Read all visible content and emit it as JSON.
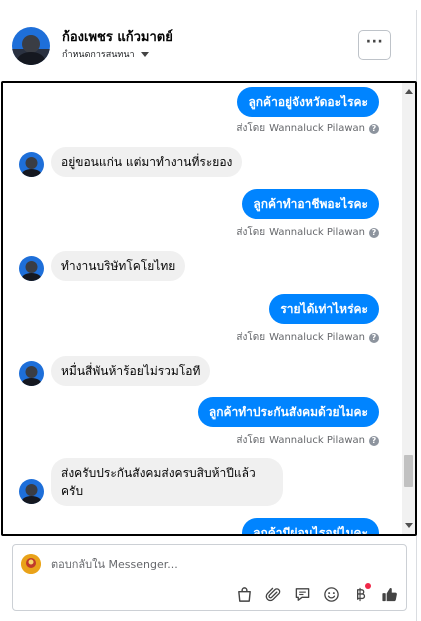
{
  "header": {
    "contact_name": "ก้องเพชร แก้วมาตย์",
    "assign_label": "กำหนดการสนทนา",
    "more_label": "···"
  },
  "messages": [
    {
      "type": "outgoing",
      "text": "ลูกค้าอยู่จังหวัดอะไรคะ"
    },
    {
      "type": "sent_by",
      "prefix": "ส่งโดย",
      "sender": "Wannaluck Pilawan",
      "info_icon": "question-circle-icon"
    },
    {
      "type": "incoming",
      "text": "อยู่ขอนแก่น แต่มาทำงานที่ระยอง"
    },
    {
      "type": "outgoing",
      "text": "ลูกค้าทำอาชีพอะไรคะ"
    },
    {
      "type": "sent_by",
      "prefix": "ส่งโดย",
      "sender": "Wannaluck Pilawan",
      "info_icon": "question-circle-icon"
    },
    {
      "type": "incoming",
      "text": "ทำงานบริษัทโคโยไทย"
    },
    {
      "type": "outgoing",
      "text": "รายได้เท่าไหร่คะ"
    },
    {
      "type": "sent_by",
      "prefix": "ส่งโดย",
      "sender": "Wannaluck Pilawan",
      "info_icon": "question-circle-icon"
    },
    {
      "type": "incoming",
      "text": "หมื่นสี่พันห้าร้อยไม่รวมโอที"
    },
    {
      "type": "outgoing",
      "text": "ลูกค้าทำประกันสังคมด้วยไมคะ"
    },
    {
      "type": "sent_by",
      "prefix": "ส่งโดย",
      "sender": "Wannaluck Pilawan",
      "info_icon": "question-circle-icon"
    },
    {
      "type": "incoming",
      "text": "ส่งครับประกันสังคมส่งครบสิบห้าปีแล้วครับ"
    },
    {
      "type": "outgoing",
      "text": "ลูกค้ามีผ่อนไรอยู่ไมคะ"
    }
  ],
  "composer": {
    "placeholder": "ตอบกลับใน Messenger...",
    "tools": [
      "shopping-bag-icon",
      "paperclip-icon",
      "saved-reply-icon",
      "emoji-icon",
      "baht-payment-icon",
      "thumbs-up-icon"
    ]
  },
  "colors": {
    "outgoing_bubble": "#0084ff",
    "incoming_bubble": "#f0f0f0",
    "notification_dot": "#f02849"
  }
}
